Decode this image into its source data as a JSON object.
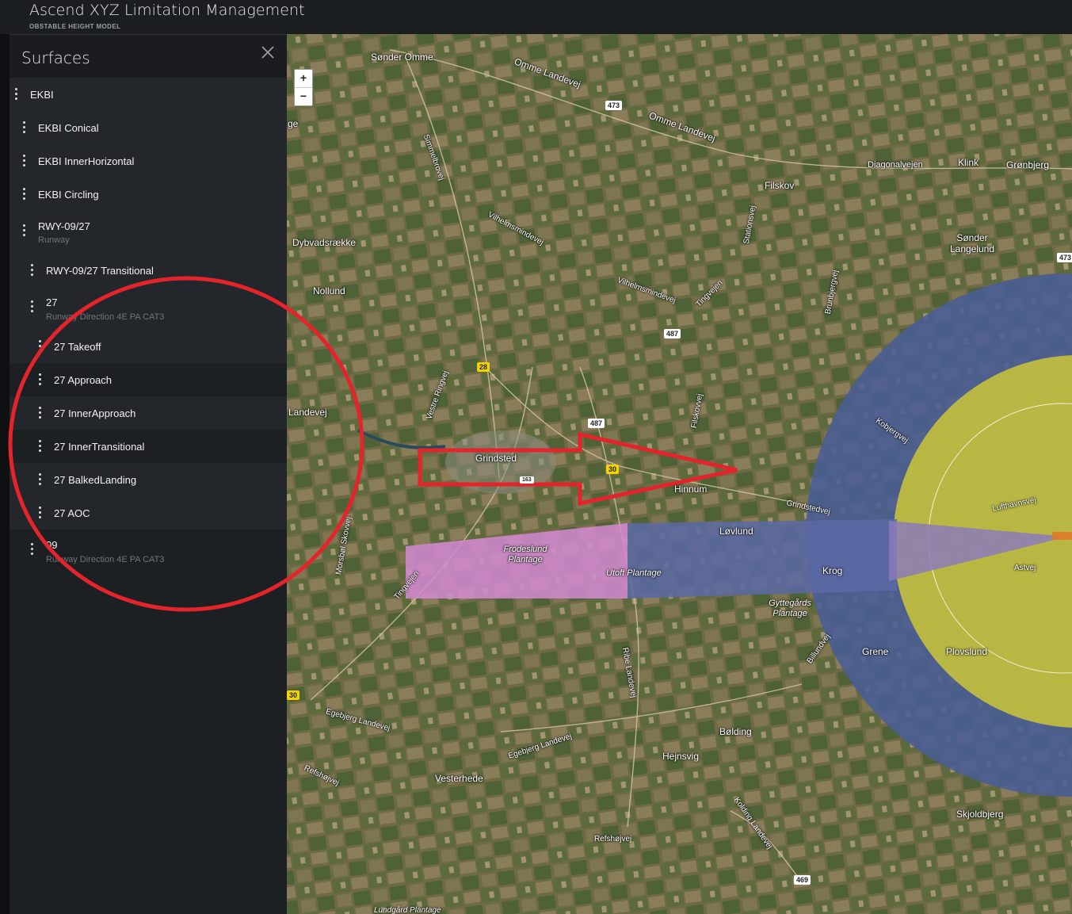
{
  "app": {
    "title": "Ascend XYZ Limitation Management",
    "subtitle": "OBSTABLE HEIGHT MODEL"
  },
  "sidebar": {
    "title": "Surfaces",
    "close_icon": "close-icon",
    "items": [
      {
        "label": "EKBI",
        "sub": ""
      },
      {
        "label": "EKBI Conical",
        "sub": ""
      },
      {
        "label": "EKBI InnerHorizontal",
        "sub": ""
      },
      {
        "label": "EKBI Circling",
        "sub": ""
      },
      {
        "label": "RWY-09/27",
        "sub": "Runway"
      },
      {
        "label": "RWY-09/27 Transitional",
        "sub": ""
      },
      {
        "label": "27",
        "sub": "Runway Direction 4E PA CAT3"
      },
      {
        "label": "27 Takeoff",
        "sub": ""
      },
      {
        "label": "27 Approach",
        "sub": ""
      },
      {
        "label": "27 InnerApproach",
        "sub": ""
      },
      {
        "label": "27 InnerTransitional",
        "sub": ""
      },
      {
        "label": "27 BalkedLanding",
        "sub": ""
      },
      {
        "label": "27 AOC",
        "sub": ""
      },
      {
        "label": "09",
        "sub": "Runway Direction 4E PA CAT3"
      }
    ]
  },
  "map": {
    "zoom_in": "+",
    "zoom_out": "−",
    "places": [
      "Sønder Omme",
      "Omme Landevej",
      "Omme Landevej",
      "Filskov",
      "Diagonalvejen",
      "Klink",
      "Grønbjerg",
      "Sønder Langelund",
      "Dybvadsrække",
      "Nollund",
      "Vilhelmsmindevej",
      "Vilhelmsmindevej",
      "Tingvejen",
      "Simmelbrovej",
      "Grindsted",
      "Hinnum",
      "Grindstedvej",
      "Løvlund",
      "Frodeslund Plantage",
      "Utoft Plantage",
      "Krog",
      "Gyttegårds Plantage",
      "Grene",
      "Plovslund",
      "Bølding",
      "Hejnsvig",
      "Vesterhede",
      "Egebjerg Landevej",
      "Egebjerg Landevej",
      "Refshøjvej",
      "Refshøjvej",
      "Kolding Landevej",
      "Skjoldbjerg",
      "Ribe Landevej",
      "Tingvejen",
      "Vestre Ringvej",
      "Billundvej",
      "Stationsvej",
      "Brunbjergvej",
      "Filskovvej",
      "Kobjergvej",
      "Lufthavnsvej",
      "Astvej",
      "Lundgård Plantage",
      "Morsbøl Skovvej",
      "Landevej",
      "ge"
    ],
    "shields": [
      "473",
      "487",
      "28",
      "487",
      "30",
      "30",
      "473",
      "469",
      "163"
    ],
    "colors": {
      "conical": "#4a5d96",
      "inner_horizontal": "#c8c43a",
      "approach": "#d38ad2",
      "annotation": "#e4242b"
    }
  }
}
